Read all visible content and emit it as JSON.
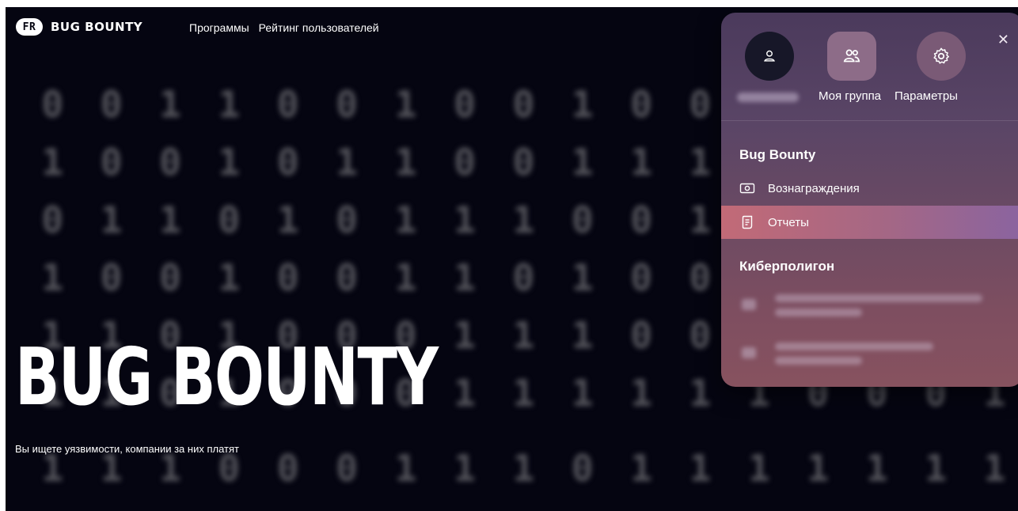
{
  "header": {
    "logo_text": "BUG BOUNTY",
    "logo_mark": "FR",
    "nav": [
      "Программы",
      "Рейтинг пользователей"
    ]
  },
  "hero": {
    "title": "BUG BOUNTY",
    "subtitle": "Вы ищете уязвимости, компании за них платят"
  },
  "background_digits": [
    "001100100100",
    "100101100111",
    "011010111001",
    "100100110100",
    "110100011100",
    "110100011111100011",
    "111000111011111111"
  ],
  "menu": {
    "close_icon": "close-icon",
    "top_items": [
      {
        "label": "",
        "icon": "user-icon"
      },
      {
        "label": "Моя группа",
        "icon": "group-icon"
      },
      {
        "label": "Параметры",
        "icon": "gear-icon"
      }
    ],
    "sections": [
      {
        "title": "Bug Bounty",
        "items": [
          {
            "label": "Вознаграждения",
            "icon": "money-icon"
          },
          {
            "label": "Отчеты",
            "icon": "document-icon",
            "active": true
          }
        ]
      },
      {
        "title": "Киберполигон",
        "items": []
      }
    ]
  },
  "colors": {
    "page_bg": "#050511",
    "menu_active_start": "#c26a77",
    "menu_active_end": "#8a64a0"
  }
}
